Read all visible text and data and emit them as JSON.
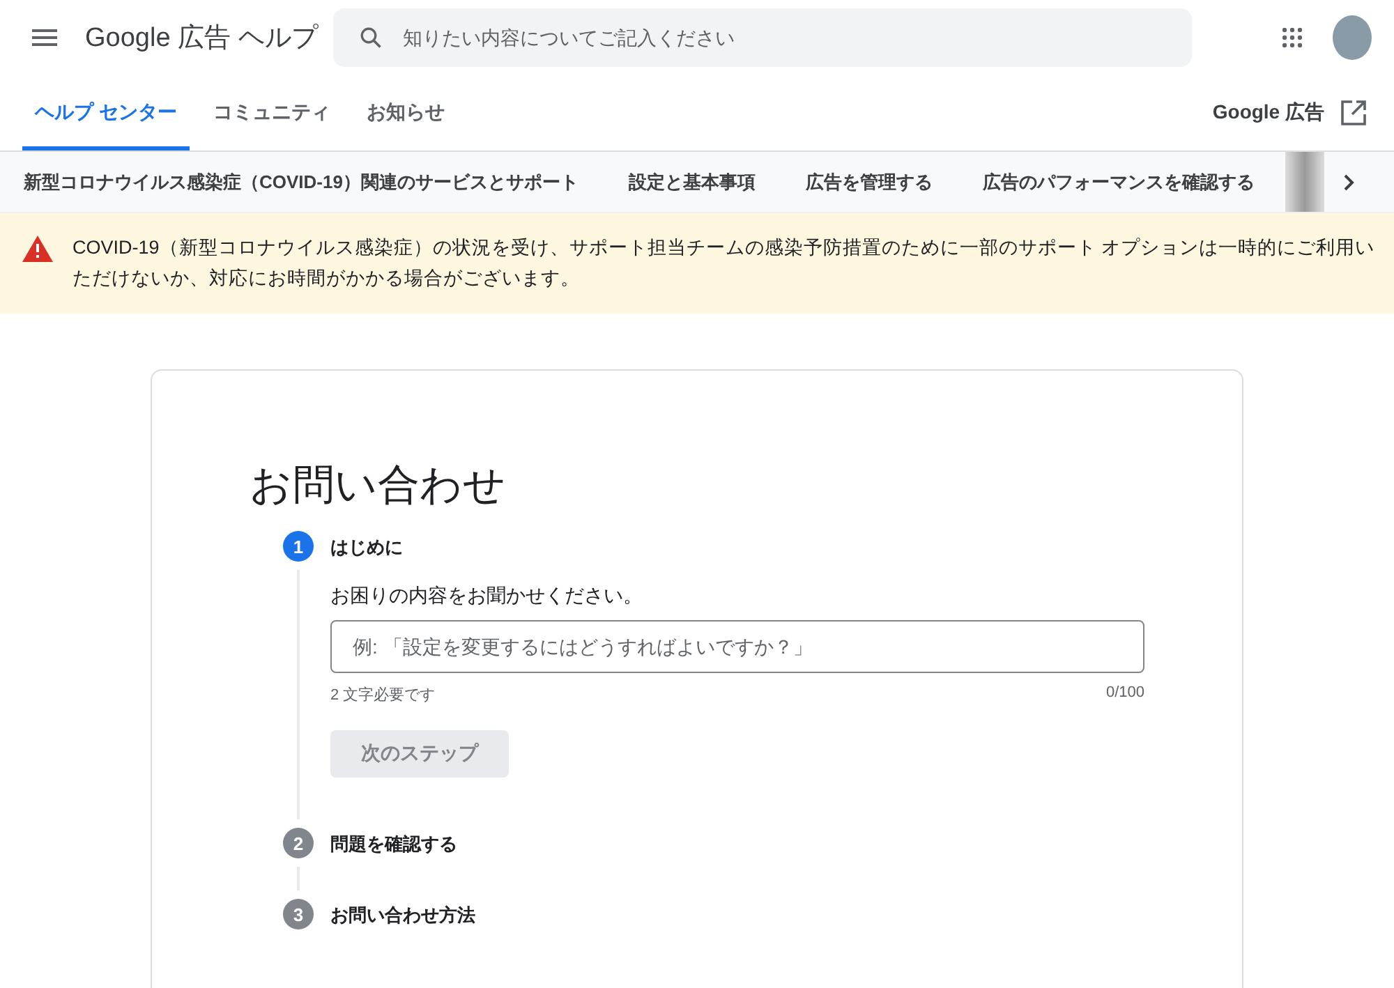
{
  "header": {
    "title": "Google 広告 ヘルプ",
    "search": {
      "placeholder": "知りたい内容についてご記入ください"
    }
  },
  "tabs": [
    {
      "label": "ヘルプ センター",
      "selected": true
    },
    {
      "label": "コミュニティ",
      "selected": false
    },
    {
      "label": "お知らせ",
      "selected": false
    }
  ],
  "product_link": "Google 広告",
  "nav_items": [
    "新型コロナウイルス感染症（COVID-19）関連のサービスとサポート",
    "設定と基本事項",
    "広告を管理する",
    "広告のパフォーマンスを確認する"
  ],
  "alert": "COVID-19（新型コロナウイルス感染症）の状況を受け、サポート担当チームの感染予防措置のために一部のサポート オプションは一時的にご利用いただけないか、対応にお時間がかかる場合がございます。",
  "form": {
    "title": "お問い合わせ",
    "steps": [
      {
        "number": "1",
        "label": "はじめに",
        "selected": true
      },
      {
        "number": "2",
        "label": "問題を確認する",
        "selected": false
      },
      {
        "number": "3",
        "label": "お問い合わせ方法",
        "selected": false
      }
    ],
    "prompt": "お困りの内容をお聞かせください。",
    "input": {
      "placeholder": "例: 「設定を変更するにはどうすればよいですか？」"
    },
    "hint": "2 文字必要です",
    "counter": "0/100",
    "next_button": {
      "label": "次のステップ",
      "disabled": true
    }
  }
}
